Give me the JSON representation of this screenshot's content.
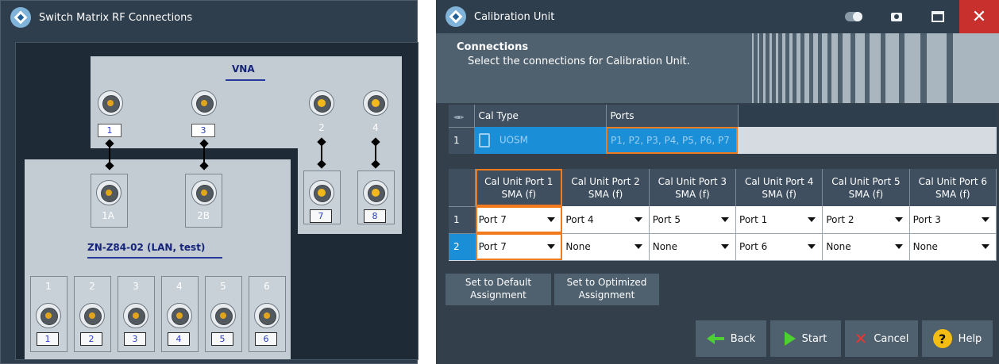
{
  "left_window": {
    "title": "Switch Matrix RF Connections",
    "vna_label": "VNA",
    "vna_ports": [
      "1",
      "3",
      "2",
      "4"
    ],
    "vna_outer_ports": [
      "7",
      "8"
    ],
    "matrix_label": "ZN-Z84-02 (LAN, test)",
    "matrix_inputs": [
      "1A",
      "2B"
    ],
    "matrix_outputs": [
      "1",
      "2",
      "3",
      "4",
      "5",
      "6"
    ]
  },
  "right_window": {
    "title": "Calibration Unit",
    "section_title": "Connections",
    "section_desc": "Select the connections for Calibration Unit.",
    "cal_table": {
      "headers": [
        "Cal Type",
        "Ports"
      ],
      "rows": [
        {
          "num": "1",
          "cal_type": "UOSM",
          "ports": "P1, P2, P3, P4, P5, P6, P7"
        }
      ]
    },
    "port_table": {
      "headers": [
        "Cal Unit Port 1\nSMA (f)",
        "Cal Unit Port 2\nSMA (f)",
        "Cal Unit Port 3\nSMA (f)",
        "Cal Unit Port 4\nSMA (f)",
        "Cal Unit Port 5\nSMA (f)",
        "Cal Unit Port 6\nSMA (f)"
      ],
      "rows": [
        {
          "num": "1",
          "cells": [
            "Port 7",
            "Port 4",
            "Port 5",
            "Port 1",
            "Port 2",
            "Port 3"
          ]
        },
        {
          "num": "2",
          "cells": [
            "Port 7",
            "None",
            "None",
            "Port 6",
            "None",
            "None"
          ]
        }
      ]
    },
    "buttons": {
      "default_assign": "Set to Default\nAssignment",
      "optimized_assign": "Set to Optimized\nAssignment",
      "back": "Back",
      "start": "Start",
      "cancel": "Cancel",
      "help": "Help"
    },
    "colors": {
      "selection": "#1a8fd8",
      "highlight": "#f07a1c",
      "close": "#c7302d",
      "go_green": "#4cd131",
      "help_yellow": "#f5bd12"
    }
  }
}
